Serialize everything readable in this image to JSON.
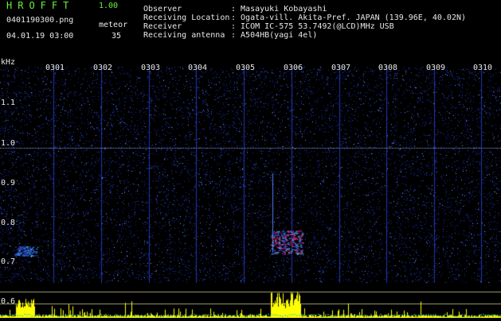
{
  "header": {
    "app_name": "HROFFT",
    "app_version": "1.00",
    "filename": "0401190300.png",
    "datetime": "04.01.19 03:00",
    "meteor_label": "meteor",
    "meteor_count": "35",
    "info": [
      {
        "key": "Observer",
        "value": ": Masayuki Kobayashi"
      },
      {
        "key": "Receiving Location",
        "value": ": Ogata-vill. Akita-Pref. JAPAN (139.96E, 40.02N)"
      },
      {
        "key": "Receiver",
        "value": ": ICOM IC-575 53.7492(@LCD)MHz USB"
      },
      {
        "key": "Receiving antenna",
        "value": ": A504HB(yagi 4el)"
      }
    ]
  },
  "axis": {
    "y_unit": "kHz",
    "y_ticks": [
      "1.1",
      "1.0",
      "0.9",
      "0.8",
      "0.7",
      "0.6"
    ],
    "x_ticks": [
      "0301",
      "0302",
      "0303",
      "0304",
      "0305",
      "0306",
      "0307",
      "0308",
      "0309",
      "0310"
    ]
  },
  "colors": {
    "header_green": "#6cf03a",
    "reference_line": "#8fa6ff",
    "signal_red": "#e02070",
    "meter_yellow": "#ffff00"
  }
}
